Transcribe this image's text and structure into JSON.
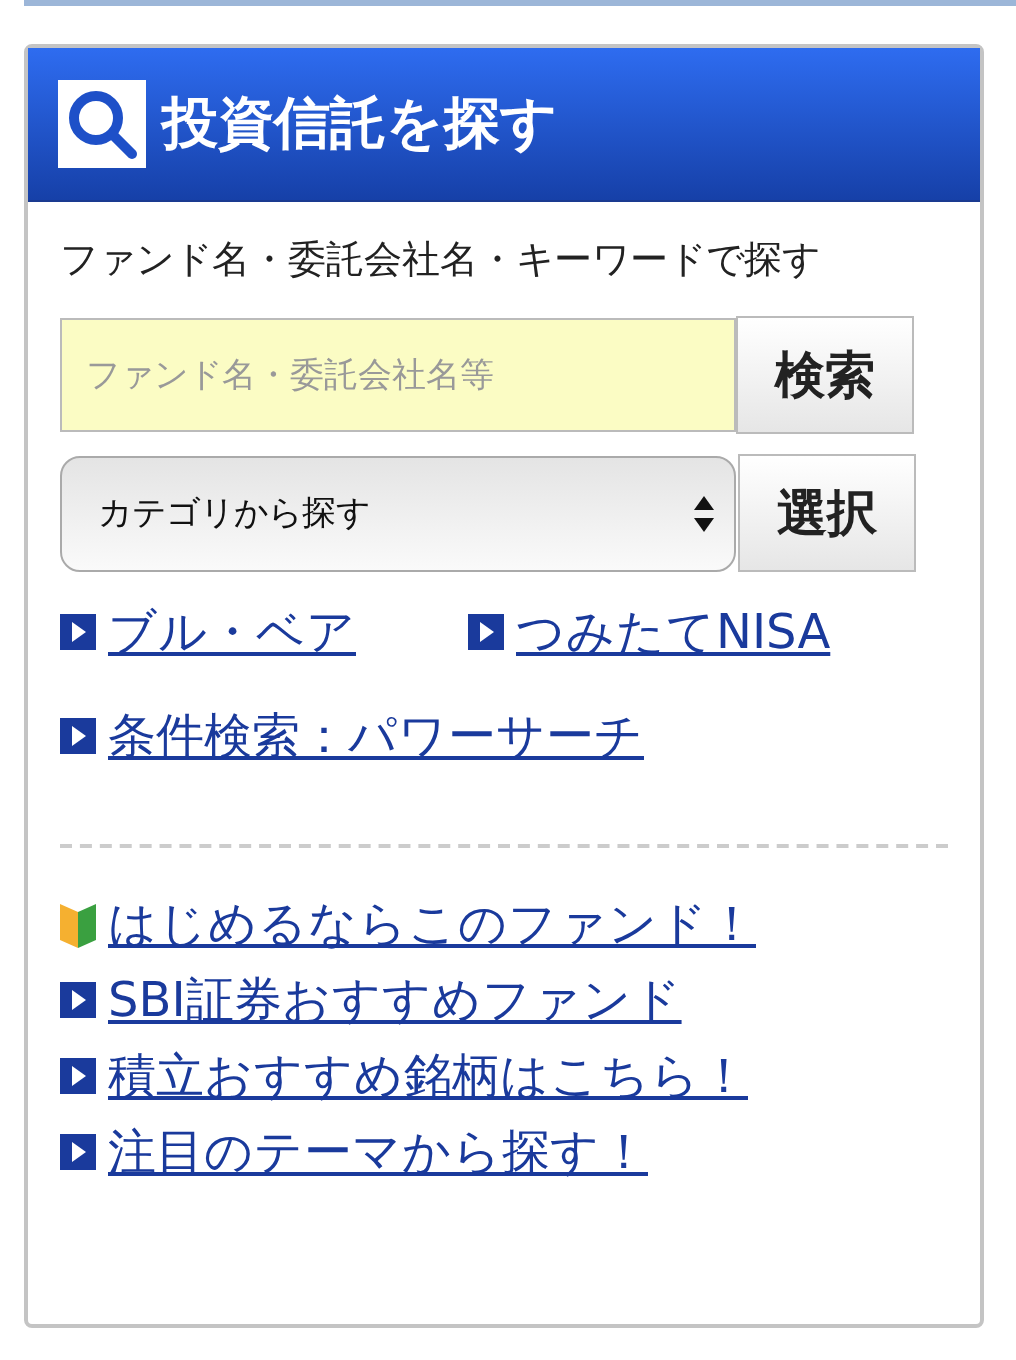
{
  "panel": {
    "title": "投資信託を探す"
  },
  "intro": "ファンド名・委託会社名・キーワードで探す",
  "search": {
    "placeholder": "ファンド名・委託会社名等",
    "button": "検索"
  },
  "category": {
    "value": "カテゴリから探す",
    "button": "選択"
  },
  "quick_links": [
    {
      "label": "ブル・ベア",
      "kind": "arrow"
    },
    {
      "label": "つみたてNISA",
      "kind": "arrow"
    },
    {
      "label": "条件検索：パワーサーチ",
      "kind": "arrow"
    }
  ],
  "featured_links": [
    {
      "label": "はじめるならこのファンド！",
      "kind": "beginner"
    },
    {
      "label": "SBI証券おすすめファンド",
      "kind": "arrow"
    },
    {
      "label": "積立おすすめ銘柄はこちら！",
      "kind": "arrow"
    },
    {
      "label": "注目のテーマから探す！",
      "kind": "arrow"
    }
  ]
}
